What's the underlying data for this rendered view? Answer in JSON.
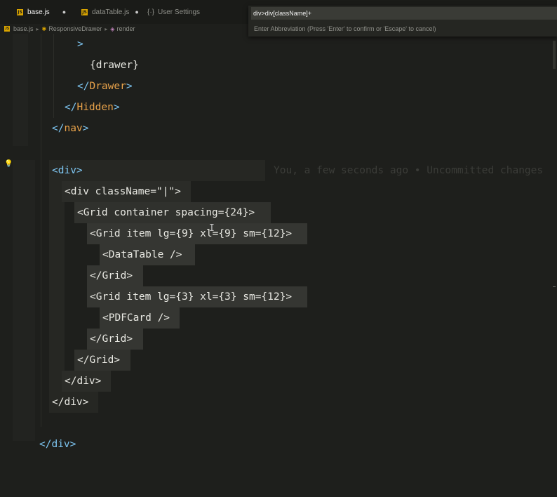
{
  "tabs": [
    {
      "label": "base.js",
      "modified": "●",
      "active": true
    },
    {
      "label": "dataTable.js",
      "modified": "●",
      "active": false
    },
    {
      "label": "User Settings",
      "active": false
    }
  ],
  "breadcrumb": {
    "file": "base.js",
    "component": "ResponsiveDrawer",
    "method": "render"
  },
  "abbreviation": {
    "value": "div>div[className]+",
    "hint": "Enter Abbreviation (Press 'Enter' to confirm or 'Escape' to cancel)"
  },
  "blame": "You, a few seconds ago • Uncommitted changes",
  "code_lines": [
    {
      "parts": [
        {
          "t": ">",
          "c": "blue"
        }
      ]
    },
    {
      "parts": [
        {
          "t": "{drawer}",
          "c": "white"
        }
      ]
    },
    {
      "parts": [
        {
          "t": "</",
          "c": "blue"
        },
        {
          "t": "Drawer",
          "c": "orange"
        },
        {
          "t": ">",
          "c": "blue"
        }
      ]
    },
    {
      "parts": [
        {
          "t": "</",
          "c": "blue"
        },
        {
          "t": "Hidden",
          "c": "orange"
        },
        {
          "t": ">",
          "c": "blue"
        }
      ]
    },
    {
      "parts": [
        {
          "t": "</",
          "c": "blue"
        },
        {
          "t": "nav",
          "c": "orange"
        },
        {
          "t": ">",
          "c": "blue"
        }
      ]
    },
    {
      "parts": []
    },
    {
      "parts": [
        {
          "t": "<div>",
          "c": "blue"
        }
      ]
    },
    {
      "parts": [
        {
          "t": "<div className=\"|\">",
          "c": "white"
        }
      ]
    },
    {
      "parts": [
        {
          "t": "<Grid container spacing={24}>",
          "c": "white"
        }
      ]
    },
    {
      "parts": [
        {
          "t": "<Grid item lg={9} xl={9} sm={12}>",
          "c": "white"
        }
      ]
    },
    {
      "parts": [
        {
          "t": "<DataTable />",
          "c": "white"
        }
      ]
    },
    {
      "parts": [
        {
          "t": "</Grid>",
          "c": "white"
        }
      ]
    },
    {
      "parts": [
        {
          "t": "<Grid item lg={3} xl={3} sm={12}>",
          "c": "white"
        }
      ]
    },
    {
      "parts": [
        {
          "t": "<PDFCard />",
          "c": "white"
        }
      ]
    },
    {
      "parts": [
        {
          "t": "</Grid>",
          "c": "white"
        }
      ]
    },
    {
      "parts": [
        {
          "t": "</Grid>",
          "c": "white"
        }
      ]
    },
    {
      "parts": [
        {
          "t": "</div>",
          "c": "white"
        }
      ]
    },
    {
      "parts": [
        {
          "t": "</div>",
          "c": "white"
        }
      ]
    },
    {
      "parts": []
    },
    {
      "parts": [
        {
          "t": "</div>",
          "c": "blue"
        }
      ]
    }
  ]
}
